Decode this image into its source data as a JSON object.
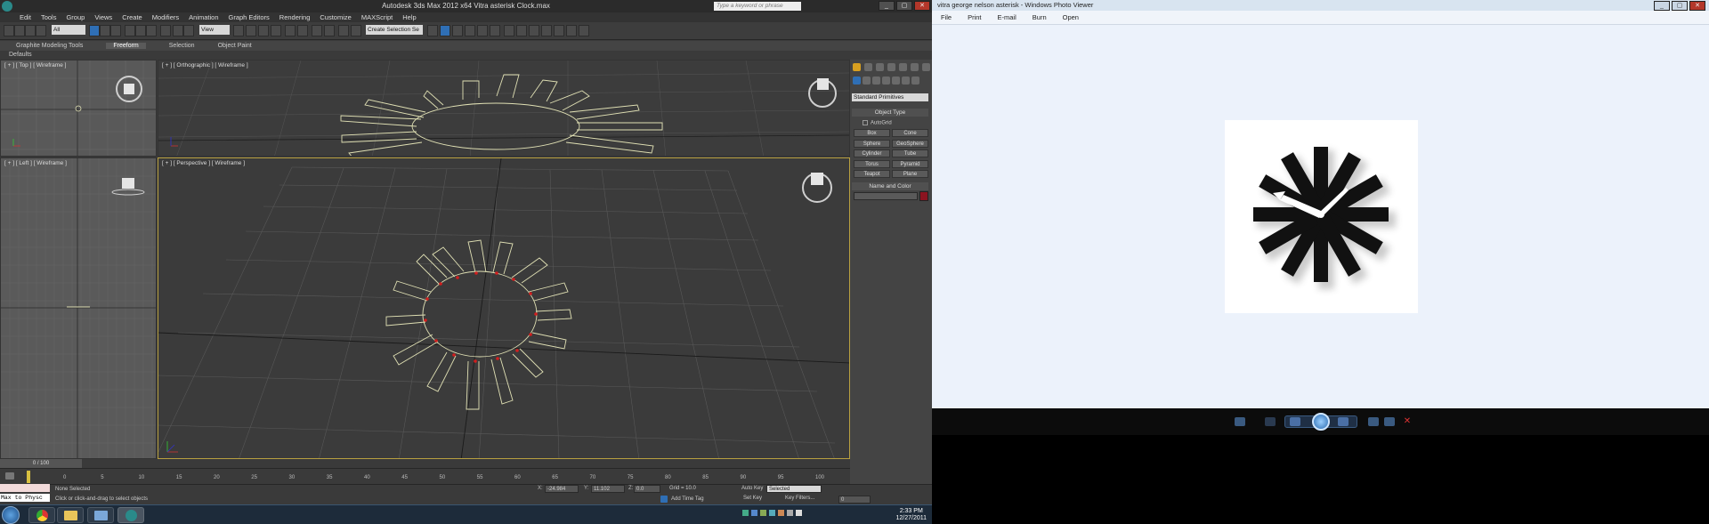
{
  "max": {
    "title": "Autodesk 3ds Max  2012 x64     Vitra asterisk Clock.max",
    "search_placeholder": "Type a keyword or phrase",
    "menu": [
      "Edit",
      "Tools",
      "Group",
      "Views",
      "Create",
      "Modifiers",
      "Animation",
      "Graph Editors",
      "Rendering",
      "Customize",
      "MAXScript",
      "Help"
    ],
    "toolbar": {
      "filter": "All",
      "view": "View",
      "named_selection": "Create Selection Se"
    },
    "ribbon": {
      "tabs": [
        "Graphite Modeling Tools",
        "Freeform",
        "Selection",
        "Object Paint"
      ],
      "active": "Freeform"
    },
    "defaults_label": "Defaults",
    "viewports": {
      "top": "[ + ] [ Top ] [ Wireframe ]",
      "ortho": "[ + ] [ Orthographic ] [ Wireframe ]",
      "left": "[ + ] [ Left ] [ Wireframe ]",
      "persp": "[ + ] [ Perspective ] [ Wireframe ]"
    },
    "command_panel": {
      "category": "Standard Primitives",
      "object_type_header": "Object Type",
      "autogrid": "AutoGrid",
      "primitives": [
        "Box",
        "Cone",
        "Sphere",
        "GeoSphere",
        "Cylinder",
        "Tube",
        "Torus",
        "Pyramid",
        "Teapot",
        "Plane"
      ],
      "name_color_header": "Name and Color"
    },
    "timeline": {
      "slider": "0 / 100",
      "ticks": [
        "0",
        "5",
        "10",
        "15",
        "20",
        "25",
        "30",
        "35",
        "40",
        "45",
        "50",
        "55",
        "60",
        "65",
        "70",
        "75",
        "80",
        "85",
        "90",
        "95",
        "100"
      ]
    },
    "status": {
      "maxscript_line": "Max to Physc",
      "selection": "None Selected",
      "prompt": "Click or click-and-drag to select objects",
      "x": "-24.984",
      "y": "11.102",
      "z": "0.0",
      "grid": "Grid = 10.0",
      "add_time_tag": "Add Time Tag",
      "auto_key": "Auto Key",
      "set_key": "Set Key",
      "key_mode": "Selected",
      "key_filters": "Key Filters...",
      "frame": "0"
    },
    "taskbar": {
      "time": "2:33 PM",
      "date": "12/27/2011"
    }
  },
  "photo_viewer": {
    "title": "vitra george nelson asterisk - Windows Photo Viewer",
    "menu": [
      "File",
      "Print",
      "E-mail",
      "Burn",
      "Open"
    ]
  },
  "colors": {
    "accent": "#2f6fb5",
    "wire": "#e0e0b4",
    "vertex": "#d21e1e",
    "clock": "#111111",
    "hand": "#ffffff"
  }
}
